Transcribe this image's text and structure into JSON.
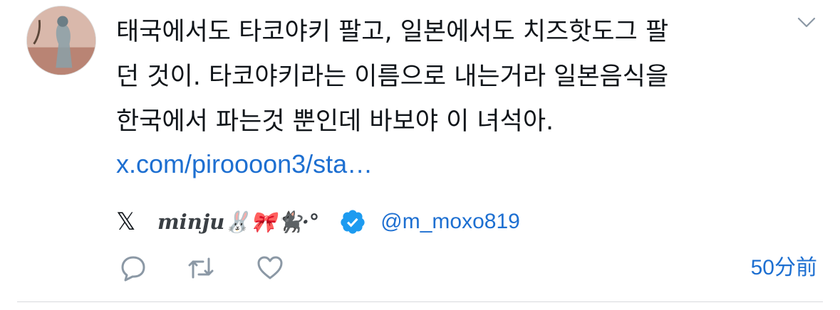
{
  "tweet": {
    "text": "태국에서도 타코야키 팔고, 일본에서도 치즈핫도그 팔\n던 것이. 타코야키라는 이름으로 내는거라 일본음식을\n한국에서 파는것 뿐인데 바보야 이 녀석아.",
    "link": "x.com/piroooon3/sta…",
    "source_icon": "x-logo-icon",
    "source_symbol": "𝕏",
    "author_display_name": "minju🐰🎀🐈‍⬛·°",
    "author_handle": "@m_moxo819",
    "verified": true,
    "timestamp": "50分前"
  },
  "actions": [
    {
      "name": "reply",
      "icon": "speech-bubble-icon"
    },
    {
      "name": "retweet",
      "icon": "retweet-icon"
    },
    {
      "name": "like",
      "icon": "heart-icon"
    }
  ],
  "colors": {
    "text": "#0f1419",
    "link": "#1d6fd1",
    "muted": "#8b98a5",
    "verified": "#1d9bf0"
  }
}
